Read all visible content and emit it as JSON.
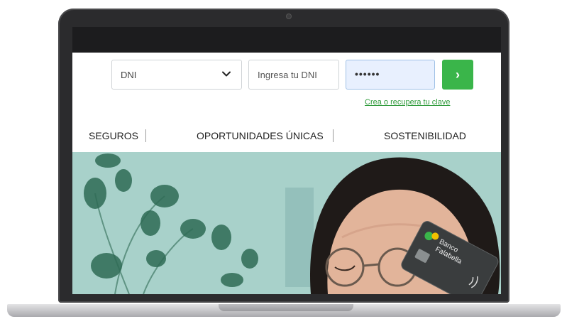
{
  "login": {
    "document_type": "DNI",
    "id_placeholder": "Ingresa tu DNI",
    "password_masked": "••••••",
    "submit_glyph": "›",
    "recover_link": "Crea o recupera tu clave"
  },
  "nav": {
    "items": [
      "SEGUROS",
      "OPORTUNIDADES ÚNICAS",
      "SOSTENIBILIDAD"
    ]
  },
  "hero": {
    "card_brand": "Banco Falabella"
  },
  "colors": {
    "accent_green": "#3ab54a",
    "link_green": "#2e9a3a",
    "password_fill": "#e8f0fe",
    "hero_teal": "#9fcac3"
  },
  "icons": {
    "select": "chevron-down-icon",
    "submit": "chevron-right-icon",
    "contactless": "contactless-icon"
  }
}
